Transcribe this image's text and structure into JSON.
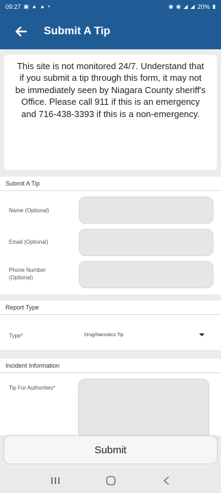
{
  "status_bar": {
    "time": "09:27",
    "battery": "20%"
  },
  "app_bar": {
    "title": "Submit A Tip",
    "back_icon": "arrow-left-icon"
  },
  "notice": {
    "text": "This site is not monitored 24/7. Understand that if you submit a tip through this form, it may not be immediately seen by Niagara County sheriff's Office. Please call 911 if this is an emergency and 716-438-3393 if this is a non-emergency."
  },
  "submit_section": {
    "header": "Submit A Tip",
    "fields": [
      {
        "label": "Name (Optional)",
        "value": ""
      },
      {
        "label": "Email (Optional)",
        "value": ""
      },
      {
        "label": "Phone Number (Optional)",
        "value": ""
      }
    ]
  },
  "report_section": {
    "header": "Report Type",
    "type_label": "Type*",
    "type_value": "Drug/Narcotics Tip"
  },
  "incident_section": {
    "header": "Incident Information",
    "tip_label": "Tip For Authorities*"
  },
  "submit_button": {
    "label": "Submit"
  },
  "nav_bar": {
    "recents_icon": "recents-icon",
    "home_icon": "home-icon",
    "back_icon": "back-chevron-icon"
  },
  "colors": {
    "primary": "#1f5c96",
    "background": "#ececec",
    "field_fill": "#e6e6e6"
  }
}
